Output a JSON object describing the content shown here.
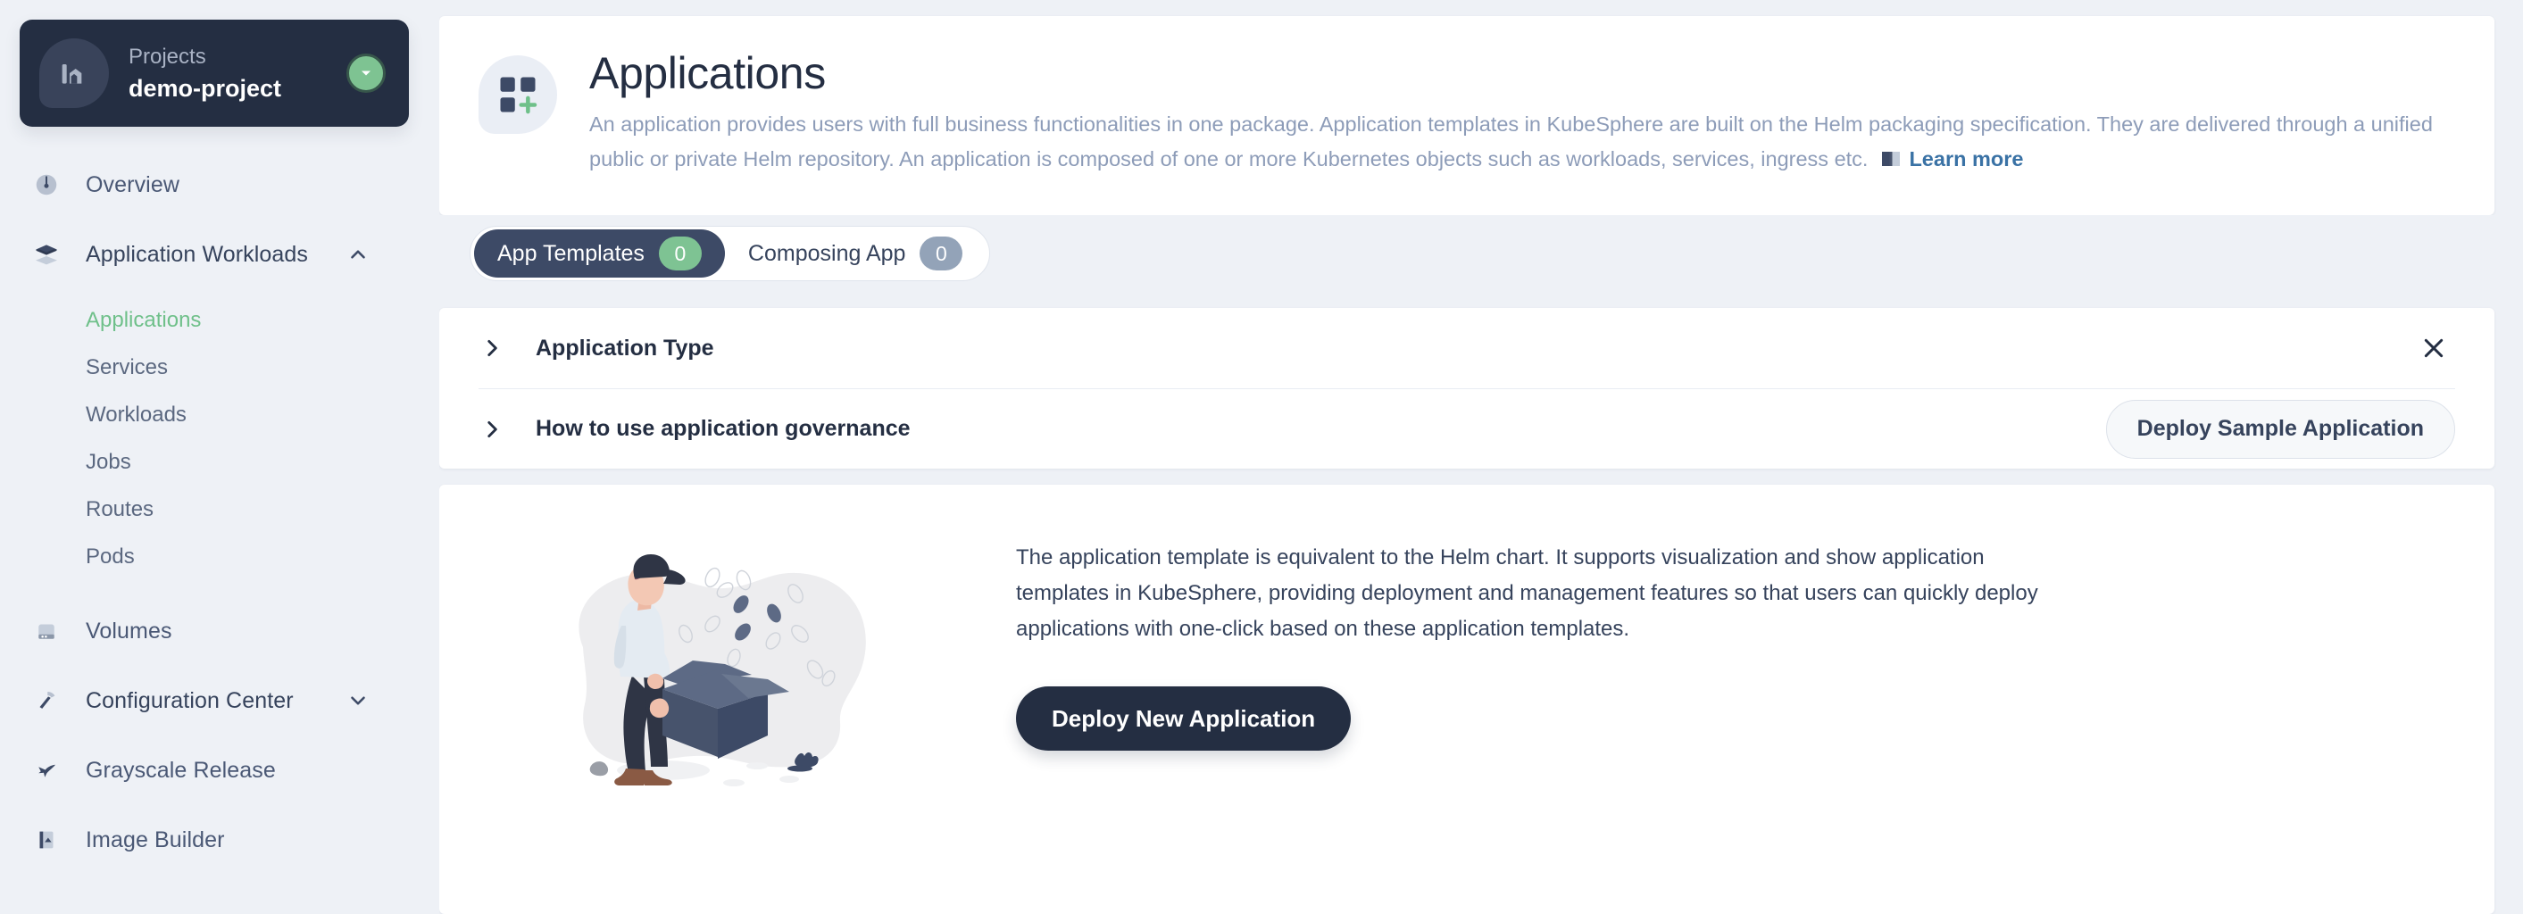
{
  "sidebar": {
    "project": {
      "label": "Projects",
      "name": "demo-project",
      "icon": "project-icon",
      "chevron": "chevron-down-icon"
    },
    "items": [
      {
        "label": "Overview",
        "icon": "dashboard-icon",
        "type": "link"
      },
      {
        "label": "Application Workloads",
        "icon": "layers-icon",
        "type": "group",
        "expanded": true,
        "chevron": "chevron-up-icon"
      },
      {
        "label": "Volumes",
        "icon": "storage-icon",
        "type": "link"
      },
      {
        "label": "Configuration Center",
        "icon": "hammer-icon",
        "type": "group",
        "expanded": false,
        "chevron": "chevron-down-icon"
      },
      {
        "label": "Grayscale Release",
        "icon": "rocket-icon",
        "type": "link"
      },
      {
        "label": "Image Builder",
        "icon": "image-icon",
        "type": "link"
      }
    ],
    "sub_items": [
      {
        "label": "Applications",
        "active": true
      },
      {
        "label": "Services",
        "active": false
      },
      {
        "label": "Workloads",
        "active": false
      },
      {
        "label": "Jobs",
        "active": false
      },
      {
        "label": "Routes",
        "active": false
      },
      {
        "label": "Pods",
        "active": false
      }
    ]
  },
  "header": {
    "icon": "applications-icon",
    "title": "Applications",
    "description": "An application provides users with full business functionalities in one package. Application templates in KubeSphere are built on the Helm packaging specification. They are delivered through a unified public or private Helm repository. An application is composed of one or more Kubernetes objects such as workloads, services, ingress etc.",
    "book_icon": "book-icon",
    "learn_more": "Learn more"
  },
  "tabs": [
    {
      "label": "App Templates",
      "count": "0",
      "active": true
    },
    {
      "label": "Composing App",
      "count": "0",
      "active": false
    }
  ],
  "accordion": [
    {
      "title": "Application Type",
      "chevron": "chevron-right-icon",
      "close_icon": "close-icon"
    },
    {
      "title": "How to use application governance",
      "chevron": "chevron-right-icon",
      "button": "Deploy Sample Application"
    }
  ],
  "empty_state": {
    "illustration": "person-carrying-box-illustration",
    "description": "The application template is equivalent to the Helm chart. It supports visualization and show application templates in KubeSphere, providing deployment and management features so that users can quickly deploy applications with one-click based on these application templates.",
    "primary_button": "Deploy New Application"
  },
  "colors": {
    "dark": "#242e42",
    "accent_green": "#7ec393",
    "active_link": "#6fc08a",
    "link_blue": "#3a72a5",
    "page_bg": "#eef1f6"
  }
}
